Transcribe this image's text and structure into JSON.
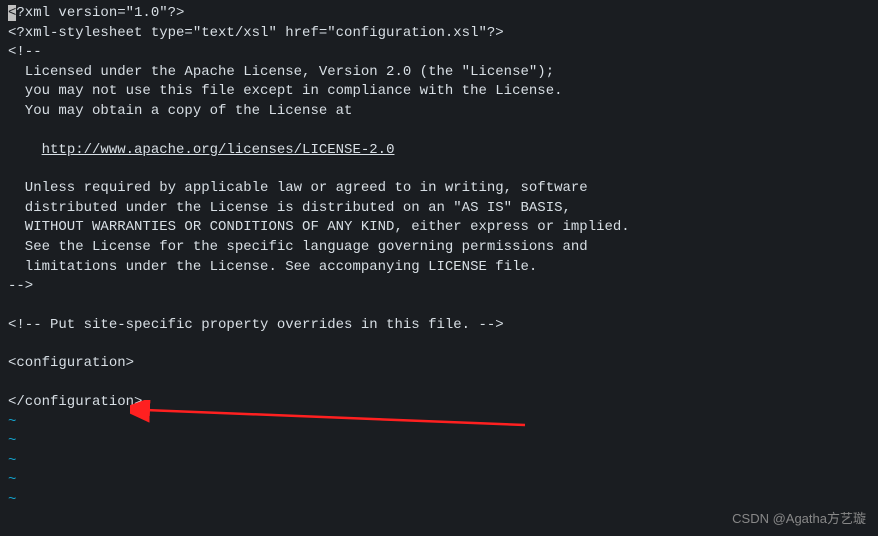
{
  "editor": {
    "lines": [
      {
        "prefix_highlight": "<",
        "prefix_rest": "?xml version=\"1.0\"?>"
      },
      {
        "text": "<?xml-stylesheet type=\"text/xsl\" href=\"configuration.xsl\"?>"
      },
      {
        "text": "<!--"
      },
      {
        "text": "  Licensed under the Apache License, Version 2.0 (the \"License\");"
      },
      {
        "text": "  you may not use this file except in compliance with the License."
      },
      {
        "text": "  You may obtain a copy of the License at"
      },
      {
        "text": ""
      },
      {
        "text": "    ",
        "link": "http://www.apache.org/licenses/LICENSE-2.0"
      },
      {
        "text": ""
      },
      {
        "text": "  Unless required by applicable law or agreed to in writing, software"
      },
      {
        "text": "  distributed under the License is distributed on an \"AS IS\" BASIS,"
      },
      {
        "text": "  WITHOUT WARRANTIES OR CONDITIONS OF ANY KIND, either express or implied."
      },
      {
        "text": "  See the License for the specific language governing permissions and"
      },
      {
        "text": "  limitations under the License. See accompanying LICENSE file."
      },
      {
        "text": "-->"
      },
      {
        "text": ""
      },
      {
        "text": "<!-- Put site-specific property overrides in this file. -->"
      },
      {
        "text": ""
      },
      {
        "text": "<configuration>"
      },
      {
        "text": ""
      },
      {
        "text": "</configuration>"
      }
    ],
    "tildes": [
      "~",
      "~",
      "~",
      "~",
      "~"
    ]
  },
  "watermark": "CSDN @Agatha方艺璇"
}
